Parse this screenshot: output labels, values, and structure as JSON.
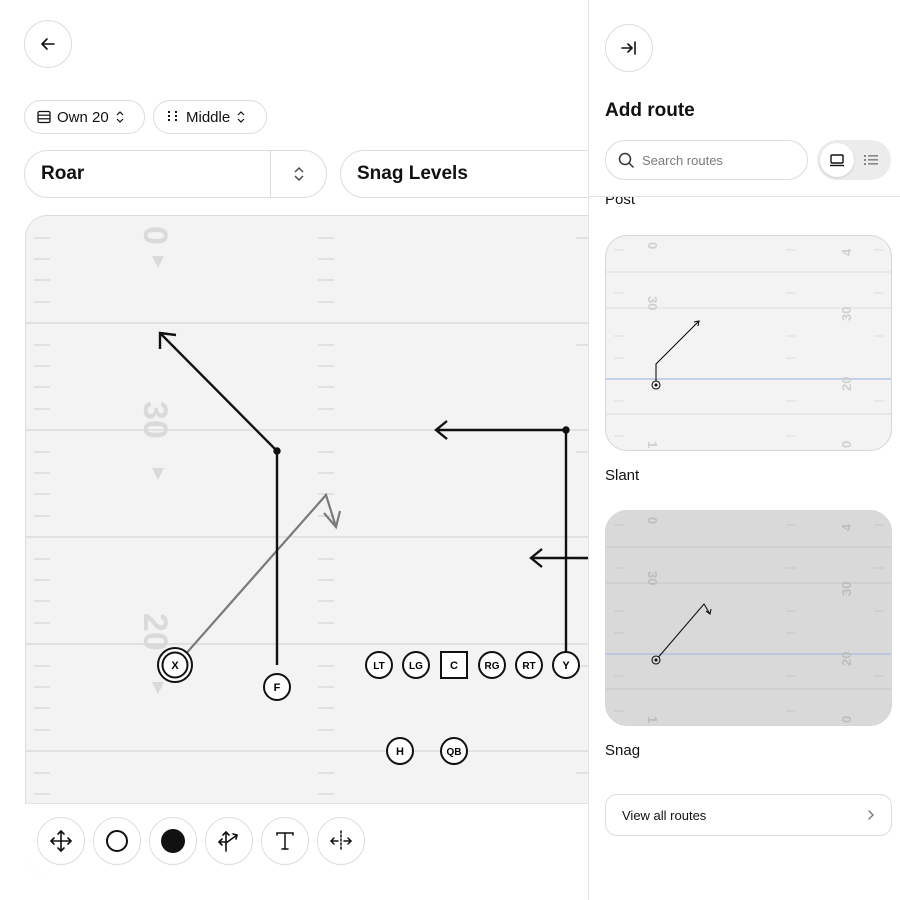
{
  "header": {
    "back_icon": "arrow-left-icon"
  },
  "filters": {
    "field_position": "Own 20",
    "hash": "Middle"
  },
  "selects": {
    "formation": "Roar",
    "play": "Snag Levels"
  },
  "field": {
    "yard_numbers": [
      "0",
      "30",
      "20"
    ],
    "players": [
      "X",
      "F",
      "LT",
      "LG",
      "C",
      "RG",
      "RT",
      "Y",
      "H",
      "QB"
    ]
  },
  "toolbar": {
    "tools": [
      "move-tool-icon",
      "empty-circle-icon",
      "filled-circle-icon",
      "route-arrow-icon",
      "text-tool-icon",
      "mirror-tool-icon"
    ]
  },
  "panel": {
    "collapse_icon": "collapse-right-icon",
    "title": "Add route",
    "search_placeholder": "Search routes",
    "routes": [
      {
        "name": "Post"
      },
      {
        "name": "Slant"
      },
      {
        "name": "Snag"
      }
    ],
    "card_numbers": {
      "left_top": "0",
      "left_mid": "30",
      "left_bottom": "1",
      "right_top": "4",
      "right_mid": "30",
      "right_mid2": "20",
      "right_bottom": "0",
      "left_small": "20"
    },
    "view_all_label": "View all routes"
  },
  "colors": {
    "field_bg": "#f3f3f3",
    "route_dark": "#111111",
    "route_grey": "#7a7a7a",
    "selected_card": "#d9d9d9",
    "los_blue": "#a9bde3"
  }
}
